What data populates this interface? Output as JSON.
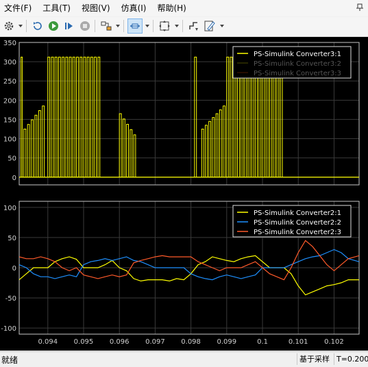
{
  "menu": [
    "文件(F)",
    "工具(T)",
    "视图(V)",
    "仿真(I)",
    "帮助(H)"
  ],
  "toolbar": {
    "buttons": [
      {
        "name": "settings-icon"
      },
      {
        "name": "restore-icon"
      },
      {
        "name": "run-icon"
      },
      {
        "name": "step-forward-icon"
      },
      {
        "name": "stop-icon"
      },
      {
        "name": "highlight-block-icon"
      },
      {
        "name": "zoom-x-icon",
        "selected": true
      },
      {
        "name": "fit-to-view-icon"
      },
      {
        "name": "triggers-icon"
      },
      {
        "name": "style-icon"
      }
    ]
  },
  "colors": {
    "background": "#000000",
    "axes_bg": "#000000",
    "grid": "#3a3a3a",
    "axes_border": "#c8c8c8",
    "tick_text": "#d0d0d0",
    "series_1": "#ffff00",
    "series_2": "#1e90ff",
    "series_3": "#ff5a2a"
  },
  "chart_data": [
    {
      "type": "line",
      "title": "",
      "xlim": [
        0.0932,
        0.1027
      ],
      "ylim": [
        -20,
        350
      ],
      "yticks": [
        0,
        50,
        100,
        150,
        200,
        250,
        300,
        350
      ],
      "legend_position": "top-right",
      "series": [
        {
          "name": "PS-Simulink Converter3:1",
          "color": "#ffff00",
          "description": "pwm-pulses",
          "pulse_trains": [
            {
              "x": [
                0.09325,
                0.09332
              ],
              "y": 312
            },
            {
              "x": [
                0.09333,
                0.09395
              ],
              "y_range": [
                125,
                185
              ]
            },
            {
              "x": [
                0.094,
                0.0952
              ],
              "y": 312
            },
            {
              "x": [
                0.0952,
                0.0955
              ],
              "y": 312
            },
            {
              "x": [
                0.096,
                0.0965
              ],
              "y_range": [
                165,
                110
              ]
            },
            {
              "x": [
                0.0981,
                0.0982
              ],
              "y": 312
            },
            {
              "x": [
                0.0983,
                0.099
              ],
              "y_range": [
                125,
                185
              ]
            },
            {
              "x": [
                0.099,
                0.1004
              ],
              "y": 312
            },
            {
              "x": [
                0.1004,
                0.1006
              ],
              "y": 312
            }
          ],
          "baseline": 0
        },
        {
          "name": "PS-Simulink Converter3:2",
          "color": "#333300",
          "values": []
        },
        {
          "name": "PS-Simulink Converter3:3",
          "color": "#331100",
          "values": []
        }
      ]
    },
    {
      "type": "line",
      "title": "",
      "xlim": [
        0.0932,
        0.1027
      ],
      "ylim": [
        -110,
        110
      ],
      "yticks": [
        -100,
        -50,
        0,
        50,
        100
      ],
      "xticks": [
        0.094,
        0.095,
        0.096,
        0.097,
        0.098,
        0.099,
        0.1,
        0.101,
        0.102
      ],
      "xticklabels": [
        "0.094",
        "0.095",
        "0.096",
        "0.097",
        "0.098",
        "0.099",
        "0.1",
        "0.101",
        "0.102"
      ],
      "legend_position": "top-right",
      "series": [
        {
          "name": "PS-Simulink Converter2:1",
          "color": "#ffff00",
          "x": [
            0.0932,
            0.0934,
            0.0936,
            0.0938,
            0.094,
            0.0942,
            0.0944,
            0.0946,
            0.0948,
            0.095,
            0.0952,
            0.0954,
            0.0956,
            0.0958,
            0.096,
            0.0962,
            0.0964,
            0.0966,
            0.0968,
            0.097,
            0.0972,
            0.0974,
            0.0976,
            0.0978,
            0.098,
            0.0982,
            0.0984,
            0.0986,
            0.0988,
            0.099,
            0.0992,
            0.0994,
            0.0996,
            0.0998,
            0.1,
            0.1002,
            0.1004,
            0.1006,
            0.1008,
            0.101,
            0.1012,
            0.1014,
            0.1016,
            0.1018,
            0.102,
            0.1022,
            0.1024,
            0.1027
          ],
          "y": [
            -20,
            -10,
            0,
            0,
            0,
            10,
            15,
            18,
            14,
            0,
            0,
            0,
            5,
            12,
            0,
            -5,
            -18,
            -22,
            -20,
            -20,
            -20,
            -22,
            -18,
            -20,
            -10,
            5,
            10,
            18,
            15,
            12,
            10,
            15,
            18,
            20,
            10,
            0,
            0,
            0,
            -10,
            -30,
            -45,
            -40,
            -35,
            -30,
            -28,
            -25,
            -20,
            -20
          ]
        },
        {
          "name": "PS-Simulink Converter2:2",
          "color": "#1e90ff",
          "x": [
            0.0932,
            0.0934,
            0.0936,
            0.0938,
            0.094,
            0.0942,
            0.0944,
            0.0946,
            0.0948,
            0.095,
            0.0952,
            0.0954,
            0.0956,
            0.0958,
            0.096,
            0.0962,
            0.0964,
            0.0966,
            0.0968,
            0.097,
            0.0972,
            0.0974,
            0.0976,
            0.0978,
            0.098,
            0.0982,
            0.0984,
            0.0986,
            0.0988,
            0.099,
            0.0992,
            0.0994,
            0.0996,
            0.0998,
            0.1,
            0.1002,
            0.1004,
            0.1006,
            0.1008,
            0.101,
            0.1012,
            0.1014,
            0.1016,
            0.1018,
            0.102,
            0.1022,
            0.1024,
            0.1027
          ],
          "y": [
            5,
            0,
            -10,
            -15,
            -15,
            -18,
            -15,
            -12,
            -15,
            5,
            10,
            12,
            15,
            12,
            15,
            18,
            12,
            10,
            5,
            0,
            0,
            0,
            0,
            0,
            -10,
            -15,
            -18,
            -20,
            -15,
            -12,
            -15,
            -18,
            -15,
            -12,
            0,
            0,
            0,
            0,
            5,
            10,
            15,
            18,
            20,
            25,
            30,
            25,
            15,
            10
          ]
        },
        {
          "name": "PS-Simulink Converter2:3",
          "color": "#ff5a2a",
          "x": [
            0.0932,
            0.0934,
            0.0936,
            0.0938,
            0.094,
            0.0942,
            0.0944,
            0.0946,
            0.0948,
            0.095,
            0.0952,
            0.0954,
            0.0956,
            0.0958,
            0.096,
            0.0962,
            0.0964,
            0.0966,
            0.0968,
            0.097,
            0.0972,
            0.0974,
            0.0976,
            0.0978,
            0.098,
            0.0982,
            0.0984,
            0.0986,
            0.0988,
            0.099,
            0.0992,
            0.0994,
            0.0996,
            0.0998,
            0.1,
            0.1002,
            0.1004,
            0.1006,
            0.1008,
            0.101,
            0.1012,
            0.1014,
            0.1016,
            0.1018,
            0.102,
            0.1022,
            0.1024,
            0.1027
          ],
          "y": [
            18,
            15,
            15,
            18,
            15,
            10,
            0,
            -5,
            0,
            -12,
            -15,
            -18,
            -15,
            -12,
            -15,
            -12,
            8,
            12,
            15,
            18,
            20,
            18,
            18,
            18,
            18,
            10,
            5,
            0,
            -5,
            0,
            0,
            0,
            5,
            10,
            0,
            -10,
            -15,
            -20,
            0,
            25,
            45,
            35,
            20,
            5,
            -5,
            5,
            15,
            20
          ]
        }
      ]
    }
  ],
  "status": {
    "left": "就绪",
    "mode": "基于采样",
    "time": "T=0.200"
  }
}
